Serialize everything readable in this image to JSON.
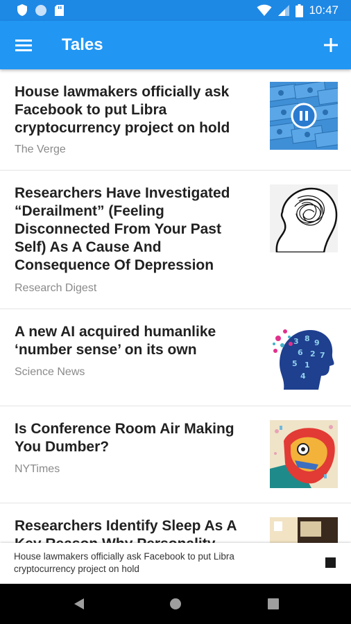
{
  "status_bar": {
    "time": "10:47",
    "icons": [
      "shield-icon",
      "circle-icon",
      "sd-card-icon",
      "wifi-icon",
      "signal-icon",
      "battery-icon"
    ]
  },
  "app_bar": {
    "title": "Tales",
    "menu_icon": "menu-icon",
    "add_icon": "plus-icon"
  },
  "colors": {
    "accent": "#2196f3",
    "status_bar": "#1e88e5",
    "title_text": "#212121",
    "source_text": "#8a8a8a"
  },
  "articles": [
    {
      "title": "House lawmakers officially ask Facebook to put Libra cryptocurrency project on hold",
      "source": "The Verge",
      "thumbnail": "dollar-bills-image",
      "playing": true
    },
    {
      "title": "Researchers Have Investigated “Derailment” (Feeling Disconnected From Your Past Self) As A Cause And Consequence Of Depression",
      "source": "Research Digest",
      "thumbnail": "scribbled-head-image"
    },
    {
      "title": "A new AI acquired humanlike ‘number sense’ on its own",
      "source": "Science News",
      "thumbnail": "numbers-head-image"
    },
    {
      "title": "Is Conference Room Air Making You Dumber?",
      "source": "NYTimes",
      "thumbnail": "colorful-face-image"
    },
    {
      "title": "Researchers Identify Sleep As A Key Reason Why Personality Traits",
      "source": "",
      "thumbnail": "room-photo-image"
    }
  ],
  "now_playing": {
    "text": "House lawmakers officially ask Facebook to put Libra cryptocurrency project on hold",
    "stop_icon": "stop-icon"
  },
  "nav_bar": {
    "icons": [
      "back-icon",
      "home-icon",
      "recents-icon"
    ]
  }
}
